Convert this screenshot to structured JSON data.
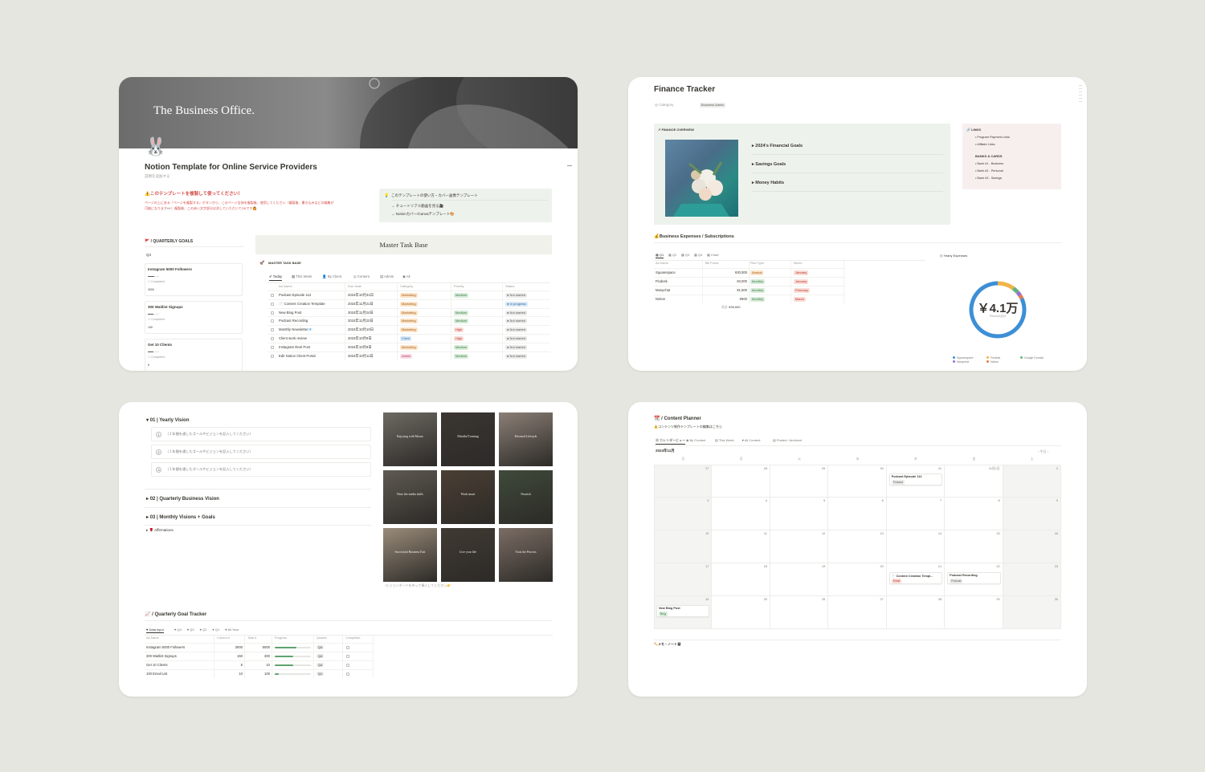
{
  "card1": {
    "cover_title": "The Business Office.",
    "avatar": "🐰",
    "title": "Notion Template for Online Service Providers",
    "subtitle": "説明を追加する",
    "warning_title": "⚠️このテンプレートを複製して使ってください！",
    "warning_body_1": "ページの上にある『ページを複製する』ボタンから、このページ全体を複製後、使用してください（複製後、書き込みなどの編集が",
    "warning_body_2": "可能になります👀）複製後、この赤い文字部分は消していただいてOKです🙆",
    "callout_title": "このテンプレートの使い方・カバー画像テンプレート",
    "callout_link_1": "→ チュートリアル動画を見る🎥",
    "callout_link_2": "→ Notionカバー/Canvaテンプレート🎨",
    "quarterly_goals_heading": "🚩 / QUARTERLY GOALS",
    "q4_label": "Q4",
    "goals": [
      {
        "name": "Instagram 5000 Followers",
        "status": "Completed",
        "value": "3000",
        "progress": 0.6
      },
      {
        "name": "300 Waitlist Signups",
        "status": "Completed",
        "value": "150",
        "progress": 0.5
      },
      {
        "name": "Get 10 Clients",
        "status": "Completed",
        "value": "5",
        "progress": 0.5
      }
    ],
    "master_title": "Master Task Base",
    "master_db_label": "MASTER TASK BASE",
    "views": [
      "Today",
      "This Week",
      "By Client",
      "Content",
      "Admin",
      "All"
    ],
    "columns": [
      "Aa Name",
      "Due Date",
      "Category",
      "Priority",
      "Status"
    ],
    "tasks": [
      {
        "name": "Podcast Episode 112",
        "date": "2024年10月31日",
        "category": "Marketing",
        "cat_color": "orange",
        "priority": "Medium",
        "pri_color": "green",
        "status": "Not started",
        "st_color": "grey"
      },
      {
        "name": "📄 Content Creation Template",
        "date": "2024年11月21日",
        "category": "Marketing",
        "cat_color": "orange",
        "priority": "",
        "pri_color": "",
        "status": "In progress",
        "st_color": "blue"
      },
      {
        "name": "New Blog Post",
        "date": "2024年11月24日",
        "category": "Marketing",
        "cat_color": "orange",
        "priority": "Medium",
        "pri_color": "green",
        "status": "Not started",
        "st_color": "grey"
      },
      {
        "name": "Podcast Recording",
        "date": "2024年11月22日",
        "category": "Marketing",
        "cat_color": "orange",
        "priority": "Medium",
        "pri_color": "green",
        "status": "Not started",
        "st_color": "grey"
      },
      {
        "name": "Monthly Newsletter📧",
        "date": "2024年10月10日",
        "category": "Marketing",
        "cat_color": "orange",
        "priority": "High",
        "pri_color": "red",
        "status": "Not started",
        "st_color": "grey"
      },
      {
        "name": "Client work review",
        "date": "2024年10月9日",
        "category": "Client",
        "cat_color": "blue",
        "priority": "High",
        "pri_color": "red",
        "status": "Not started",
        "st_color": "grey"
      },
      {
        "name": "Instagram Reel Post",
        "date": "2024年10月8日",
        "category": "Marketing",
        "cat_color": "orange",
        "priority": "Medium",
        "pri_color": "green",
        "status": "Not started",
        "st_color": "grey"
      },
      {
        "name": "Edit Notion Client Portal",
        "date": "2024年10月11日",
        "category": "Admin",
        "cat_color": "pink",
        "priority": "Medium",
        "pri_color": "green",
        "status": "Not started",
        "st_color": "grey"
      }
    ]
  },
  "card2": {
    "title": "Finance Tracker",
    "category_label": "Category",
    "category_value": "Business Admin",
    "overview_label": "FINANCE OVERVIEW",
    "toggles": [
      "2024's Financial Goals",
      "Savings Goals",
      "Money Habits"
    ],
    "links_heading": "LINKS",
    "links": [
      "Program Payment Links",
      "Affiliate Links"
    ],
    "banks_heading": "BANKS & CARDS",
    "banks": [
      "Bank #1 - Business",
      "Bank #2 - Personal",
      "Bank #3 - Savings"
    ],
    "expenses_heading": "💰Business Expenses / Subscriptions",
    "tabs": [
      "Q1",
      "Q2",
      "Q3",
      "Q4",
      "Chart"
    ],
    "yearly_label": "Yearly Expenses",
    "exp_columns": [
      "Aa Name",
      "Bill Prices",
      "Plan Type",
      "Month"
    ],
    "expenses": [
      {
        "name": "Squarespace",
        "price": "¥30,000",
        "plan": "Annual",
        "plan_color": "orange",
        "month": "January"
      },
      {
        "name": "Flodesk",
        "price": "¥3,000",
        "plan": "Monthly",
        "plan_color": "green",
        "month": "January"
      },
      {
        "name": "Manychat",
        "price": "¥1,500",
        "plan": "Monthly",
        "plan_color": "green",
        "month": "February"
      },
      {
        "name": "Notion",
        "price": "¥500",
        "plan": "Monthly",
        "plan_color": "green",
        "month": "March"
      }
    ],
    "sum_label": "合計",
    "sum_value": "¥35,500",
    "donut_value": "￥4.1万",
    "donut_sub": "Pricesの合計",
    "legend": [
      {
        "name": "Squarespace",
        "color": "#3d8fd6"
      },
      {
        "name": "Flodesk",
        "color": "#f0b44a"
      },
      {
        "name": "Google Domain",
        "color": "#62b37a"
      },
      {
        "name": "Manychat",
        "color": "#9d6fd0"
      },
      {
        "name": "Notion",
        "color": "#e87a4a"
      }
    ]
  },
  "card3": {
    "yearly_vision": "01 | Yearly Vision",
    "vision_items": [
      "1",
      "2",
      "3"
    ],
    "vision_placeholder": "（１年間を通したゴールやビジョンを記入してください）",
    "quarterly_vision": "02 | Quarterly Business Vision",
    "monthly_vision": "03 | Monthly Visions + Goals",
    "affirmations": "Affirmations",
    "board_captions": [
      "Enjoying with Moose",
      "Mindful Training",
      "Elevated Lifestyle",
      "Have the media skills",
      "Work smart",
      "Nourish",
      "Successful Business Exit",
      "Live your life",
      "Trust the Process"
    ],
    "board_note": "*ビジョンボードを作って挿入してください👉",
    "tracker_heading": "📈 / Quarterly Goal Tracker",
    "tracker_tabs": [
      "Data input",
      "Q4",
      "Q3",
      "Q2",
      "Q1",
      "All Year"
    ],
    "tracker_columns": [
      "Aa Name",
      "Current #",
      "Total #",
      "Progress",
      "Quarter",
      "Completed"
    ],
    "tracker_rows": [
      {
        "name": "Instagram 5000 Followers",
        "current": "3000",
        "total": "5000",
        "progress": 0.6,
        "quarter": "Q4"
      },
      {
        "name": "300 Waitlist Signups",
        "current": "150",
        "total": "300",
        "progress": 0.5,
        "quarter": "Q4"
      },
      {
        "name": "Get 10 Clients",
        "current": "5",
        "total": "10",
        "progress": 0.5,
        "quarter": "Q4"
      },
      {
        "name": "100 Email List",
        "current": "10",
        "total": "100",
        "progress": 0.1,
        "quarter": "Q1"
      }
    ]
  },
  "card4": {
    "title": "📆 / Content Planner",
    "subtitle": "⚠️コンテンツ制作テンプレートの編集はこちら",
    "tabs": [
      "カレンダービュー",
      "By Content",
      "This Week",
      "All Content",
      "Posted / Archived"
    ],
    "month": "2024年11月",
    "today": "今日",
    "weekdays": [
      "日",
      "月",
      "火",
      "水",
      "木",
      "金",
      "土"
    ],
    "days": [
      "27",
      "28",
      "29",
      "30",
      "31",
      "11月1日",
      "2",
      "3",
      "4",
      "5",
      "6",
      "7",
      "8",
      "9",
      "10",
      "11",
      "12",
      "13",
      "14",
      "15",
      "16",
      "17",
      "18",
      "19",
      "20",
      "21",
      "22",
      "23",
      "24",
      "25",
      "26",
      "27",
      "28",
      "29",
      "30"
    ],
    "events": [
      {
        "cell": 4,
        "title": "Podcast Episode 112",
        "tag": "Podcast",
        "tag_color": "grey"
      },
      {
        "cell": 25,
        "title": "📄 Content Creation Templ...",
        "tag": "Email",
        "tag_color": "red"
      },
      {
        "cell": 26,
        "title": "Podcast Recording",
        "tag": "Podcast",
        "tag_color": "grey"
      },
      {
        "cell": 28,
        "title": "New Blog Post",
        "tag": "Blog",
        "tag_color": "green"
      }
    ],
    "memo": "✏️メモ・ノート📓"
  }
}
